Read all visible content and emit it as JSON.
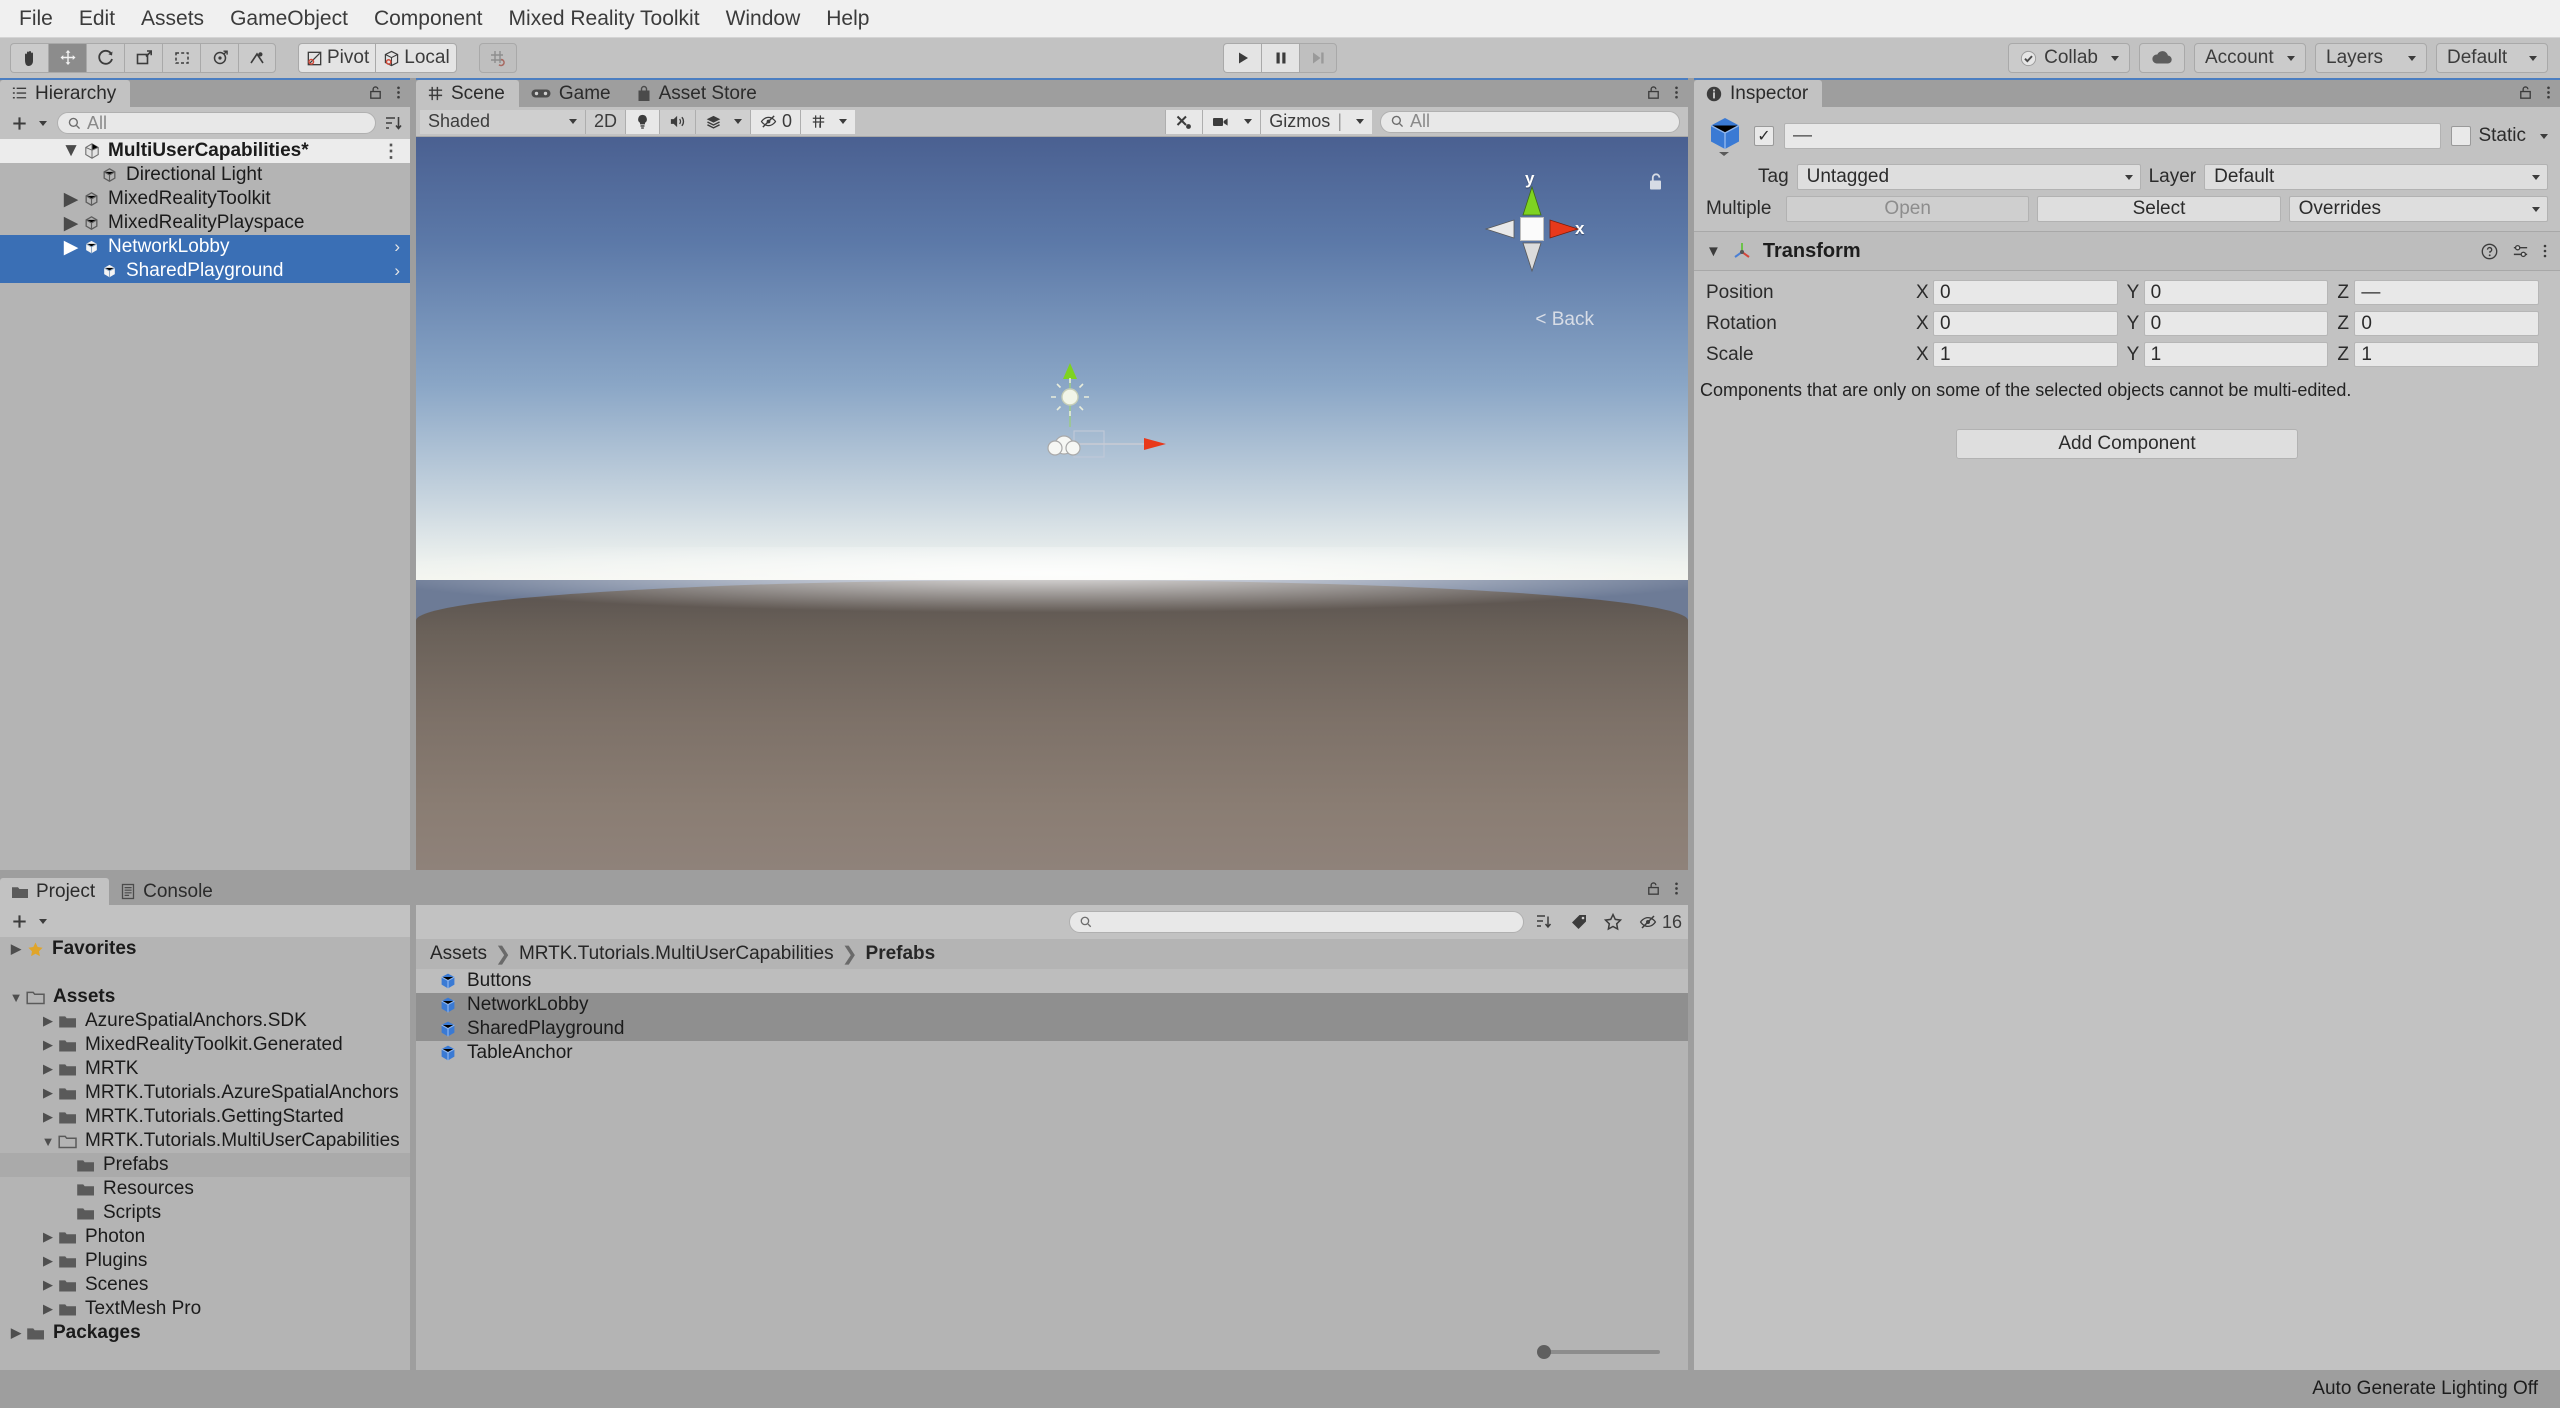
{
  "menubar": {
    "items": [
      {
        "label": "File"
      },
      {
        "label": "Edit"
      },
      {
        "label": "Assets"
      },
      {
        "label": "GameObject"
      },
      {
        "label": "Component"
      },
      {
        "label": "Mixed Reality Toolkit"
      },
      {
        "label": "Window"
      },
      {
        "label": "Help"
      }
    ]
  },
  "toolbar": {
    "tools": [
      {
        "name": "hand-tool",
        "active": false
      },
      {
        "name": "move-tool",
        "active": true
      },
      {
        "name": "rotate-tool",
        "active": false
      },
      {
        "name": "scale-tool",
        "active": false
      },
      {
        "name": "rect-tool",
        "active": false
      },
      {
        "name": "transform-tool",
        "active": false
      },
      {
        "name": "custom-editor-tool",
        "active": false
      }
    ],
    "pivot_label": "Pivot",
    "local_label": "Local",
    "grid_snap_label": "",
    "play_label": "play",
    "pause_label": "pause",
    "step_label": "step",
    "collab_label": "Collab",
    "cloud_label": "",
    "account_label": "Account",
    "layers_label": "Layers",
    "layout_label": "Default"
  },
  "hierarchy": {
    "tab_label": "Hierarchy",
    "search_placeholder": "All",
    "create_label": "+",
    "items": [
      {
        "label": "MultiUserCapabilities*",
        "depth": 0,
        "expanded": true,
        "selected": false,
        "root": true,
        "icon": "unity-scene-icon",
        "kebab": true
      },
      {
        "label": "Directional Light",
        "depth": 1,
        "expanded": null,
        "selected": false,
        "root": false,
        "icon": "gameobject-icon"
      },
      {
        "label": "MixedRealityToolkit",
        "depth": 1,
        "expanded": false,
        "selected": false,
        "root": false,
        "icon": "gameobject-icon"
      },
      {
        "label": "MixedRealityPlayspace",
        "depth": 1,
        "expanded": false,
        "selected": false,
        "root": false,
        "icon": "gameobject-icon"
      },
      {
        "label": "NetworkLobby",
        "depth": 1,
        "expanded": false,
        "selected": true,
        "root": false,
        "icon": "prefab-icon",
        "chevron": true
      },
      {
        "label": "SharedPlayground",
        "depth": 1,
        "expanded": null,
        "selected": true,
        "root": false,
        "icon": "prefab-icon",
        "chevron": true
      }
    ]
  },
  "scene": {
    "tabs": [
      {
        "label": "Scene",
        "icon": "grid-icon",
        "selected": true
      },
      {
        "label": "Game",
        "icon": "gamepad-icon",
        "selected": false
      },
      {
        "label": "Asset Store",
        "icon": "store-icon",
        "selected": false
      }
    ],
    "draw_mode": "Shaded",
    "mode_2d": "2D",
    "lighting_icon": "light-bulb-icon",
    "audio_icon": "audio-icon",
    "fx_icon": "effects-icon",
    "hidden_count": "0",
    "grid_icon": "grid-visibility-icon",
    "tools_icon": "scene-tools-icon",
    "camera_icon": "scene-camera-icon",
    "gizmos_label": "Gizmos",
    "gizmo_search_placeholder": "All",
    "view_gizmo": {
      "y_label": "y",
      "x_label": "x",
      "back_label": "Back",
      "back_prefix": "<"
    }
  },
  "inspector": {
    "tab_label": "Inspector",
    "name_value": "—",
    "static_label": "Static",
    "tag_label": "Tag",
    "tag_value": "Untagged",
    "layer_label": "Layer",
    "layer_value": "Default",
    "multiple_label": "Multiple",
    "open_label": "Open",
    "select_label": "Select",
    "overrides_label": "Overrides",
    "transform": {
      "title": "Transform",
      "rows": [
        {
          "label": "Position",
          "x": "0",
          "y": "0",
          "z": "—"
        },
        {
          "label": "Rotation",
          "x": "0",
          "y": "0",
          "z": "0"
        },
        {
          "label": "Scale",
          "x": "1",
          "y": "1",
          "z": "1"
        }
      ],
      "axis_labels": [
        "X",
        "Y",
        "Z"
      ]
    },
    "multi_edit_note": "Components that are only on some of the selected objects cannot be multi-edited.",
    "add_component_label": "Add Component"
  },
  "project": {
    "tabs": [
      {
        "label": "Project",
        "icon": "folder-icon",
        "selected": true
      },
      {
        "label": "Console",
        "icon": "console-icon",
        "selected": false
      }
    ],
    "search_placeholder": "",
    "item_count": "16",
    "tree": [
      {
        "label": "Favorites",
        "depth": 0,
        "expanded": false,
        "bold": true,
        "icon": "star-icon"
      },
      {
        "label": "",
        "depth": 0,
        "spacer": true
      },
      {
        "label": "Assets",
        "depth": 0,
        "expanded": true,
        "bold": true,
        "icon": "folder-open-icon"
      },
      {
        "label": "AzureSpatialAnchors.SDK",
        "depth": 1,
        "expanded": false,
        "icon": "folder-icon"
      },
      {
        "label": "MixedRealityToolkit.Generated",
        "depth": 1,
        "expanded": false,
        "icon": "folder-icon"
      },
      {
        "label": "MRTK",
        "depth": 1,
        "expanded": false,
        "icon": "folder-icon"
      },
      {
        "label": "MRTK.Tutorials.AzureSpatialAnchors",
        "depth": 1,
        "expanded": false,
        "icon": "folder-icon"
      },
      {
        "label": "MRTK.Tutorials.GettingStarted",
        "depth": 1,
        "expanded": false,
        "icon": "folder-icon"
      },
      {
        "label": "MRTK.Tutorials.MultiUserCapabilities",
        "depth": 1,
        "expanded": true,
        "icon": "folder-open-icon"
      },
      {
        "label": "Prefabs",
        "depth": 2,
        "expanded": null,
        "icon": "folder-icon",
        "highlighted": true
      },
      {
        "label": "Resources",
        "depth": 2,
        "expanded": null,
        "icon": "folder-icon"
      },
      {
        "label": "Scripts",
        "depth": 2,
        "expanded": null,
        "icon": "folder-icon"
      },
      {
        "label": "Photon",
        "depth": 1,
        "expanded": false,
        "icon": "folder-icon"
      },
      {
        "label": "Plugins",
        "depth": 1,
        "expanded": false,
        "icon": "folder-icon"
      },
      {
        "label": "Scenes",
        "depth": 1,
        "expanded": false,
        "icon": "folder-icon"
      },
      {
        "label": "TextMesh Pro",
        "depth": 1,
        "expanded": false,
        "icon": "folder-icon"
      },
      {
        "label": "Packages",
        "depth": 0,
        "expanded": false,
        "bold": true,
        "icon": "folder-icon"
      }
    ],
    "breadcrumb": [
      "Assets",
      "MRTK.Tutorials.MultiUserCapabilities",
      "Prefabs"
    ],
    "assets": [
      {
        "label": "Buttons",
        "icon": "prefab-icon",
        "selected": false
      },
      {
        "label": "NetworkLobby",
        "icon": "prefab-icon",
        "selected": true
      },
      {
        "label": "SharedPlayground",
        "icon": "prefab-icon",
        "selected": true
      },
      {
        "label": "TableAnchor",
        "icon": "prefab-icon",
        "selected": false
      }
    ]
  },
  "statusbar": {
    "message": "Auto Generate Lighting Off"
  },
  "colors": {
    "accent_blue": "#3a6fb5",
    "tab_accent": "#4b7ec1",
    "panel_bg": "#c2c2c2",
    "list_bg": "#b4b4b4",
    "prefab_blue": "#3a7ad4",
    "star_gold": "#e0a52a"
  }
}
